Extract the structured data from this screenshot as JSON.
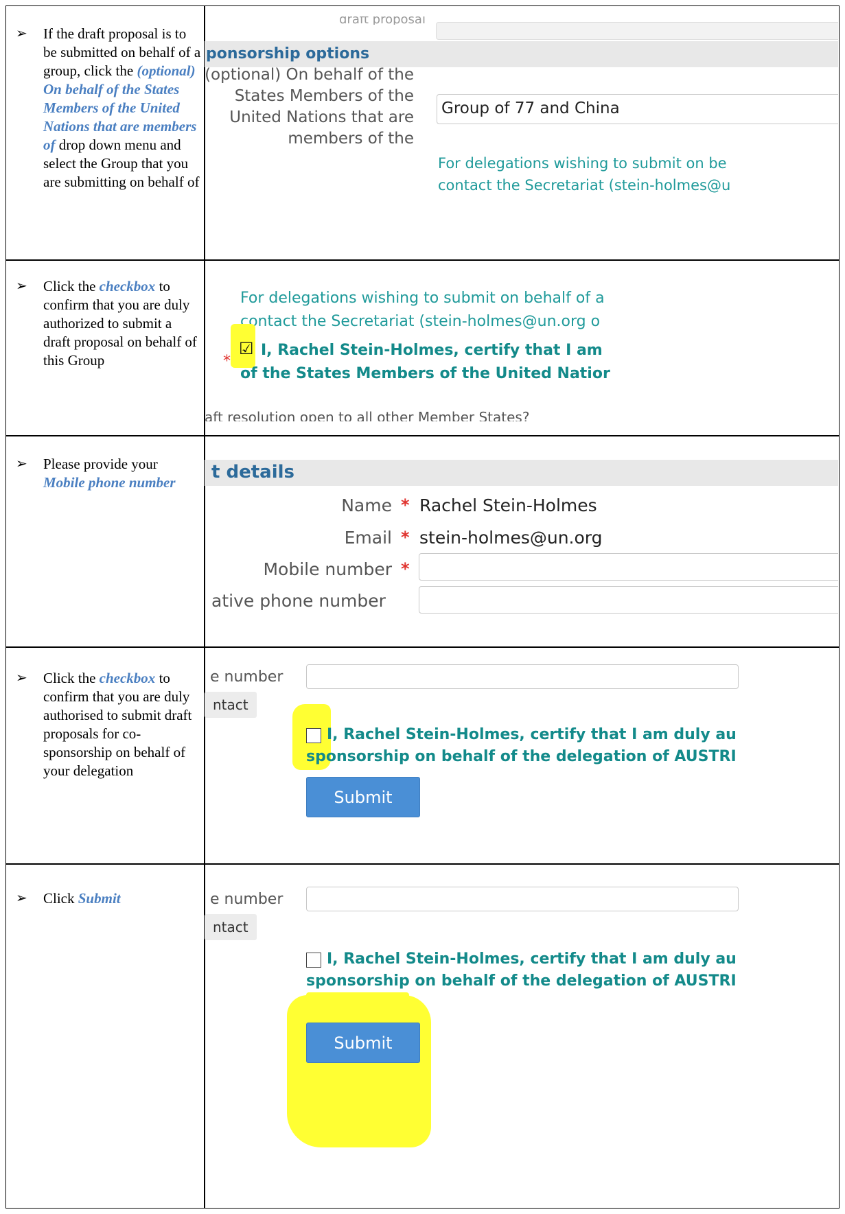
{
  "rows": [
    {
      "arrow": "➢",
      "parts": [
        {
          "t": "If the draft proposal is to be submitted on behalf of a group, click the ",
          "h": false
        },
        {
          "t": "(optional) On behalf of the States Members of the United Nations that are members of",
          "h": true
        },
        {
          "t": " drop down menu and select the Group that you are submitting on behalf of",
          "h": false
        }
      ],
      "shot": {
        "top_text": "draft proposal",
        "section": "ponsorship options",
        "label_lines": [
          "(optional) On behalf of the",
          "States Members of the",
          "United Nations that are",
          "members of the"
        ],
        "select_value": "Group of 77 and China",
        "note_lines": [
          "For delegations wishing to submit on be",
          "contact the Secretariat (stein-holmes@u"
        ]
      }
    },
    {
      "arrow": "➢",
      "parts": [
        {
          "t": "Click the ",
          "h": false
        },
        {
          "t": "checkbox",
          "h": true
        },
        {
          "t": " to confirm that you are duly authorized to submit a draft proposal on behalf of this Group",
          "h": false
        }
      ],
      "shot": {
        "note_lines": [
          "For delegations wishing to submit on behalf of a",
          "contact the Secretariat (stein-holmes@un.org o"
        ],
        "certify_lines": [
          "I, Rachel Stein-Holmes, certify that I am",
          "of the States Members of the United Natior"
        ],
        "check_mark": "☑",
        "star": "*",
        "bottom_text": "aft resolution open to all other Member States?"
      }
    },
    {
      "arrow": "➢",
      "parts": [
        {
          "t": "Please provide your ",
          "h": false
        },
        {
          "t": "Mobile phone number",
          "h": true
        }
      ],
      "shot": {
        "section": "t details",
        "name_label": "Name",
        "name_value": "Rachel Stein-Holmes",
        "email_label": "Email",
        "email_value": "stein-holmes@un.org",
        "mobile_label": "Mobile number",
        "alt_label": "ative phone number",
        "star": "*"
      }
    },
    {
      "arrow": "➢",
      "parts": [
        {
          "t": "Click the ",
          "h": false
        },
        {
          "t": "checkbox",
          "h": true
        },
        {
          "t": " to confirm that you are duly authorised to submit draft proposals for co-sponsorship on behalf of your delegation",
          "h": false
        }
      ],
      "shot": {
        "phone_label": "e number",
        "contact_label": "ntact",
        "certify_lines": [
          "I, Rachel Stein-Holmes, certify that I am duly au",
          "sponsorship on behalf of the delegation of AUSTRI"
        ],
        "submit_label": "Submit"
      }
    },
    {
      "arrow": "➢",
      "parts": [
        {
          "t": "Click ",
          "h": false
        },
        {
          "t": "Submit",
          "h": true
        }
      ],
      "shot": {
        "phone_label": "e number",
        "contact_label": "ntact",
        "certify_lines": [
          "I, Rachel Stein-Holmes, certify that I am duly au",
          "sponsorship on behalf of the delegation of AUSTRI"
        ],
        "submit_label": "Submit"
      }
    }
  ]
}
